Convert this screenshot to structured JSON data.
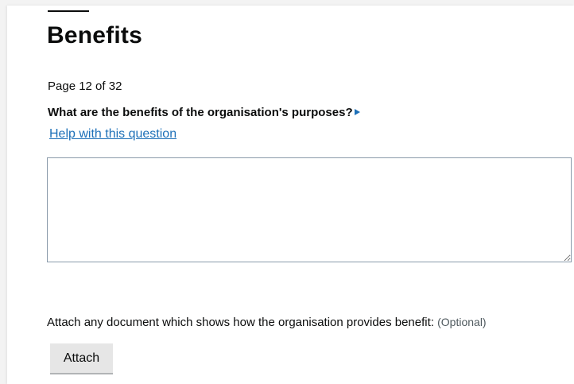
{
  "page": {
    "title": "Benefits",
    "counter": "Page 12 of 32"
  },
  "question": {
    "text": "What are the benefits of the organisation's purposes?",
    "help_link": "Help with this question",
    "answer_value": ""
  },
  "attachment": {
    "label": "Attach any document which shows how the organisation provides benefit:",
    "optional": "(Optional)",
    "button_label": "Attach"
  },
  "icons": {
    "question_expand": "triangle-right-icon"
  },
  "colors": {
    "link": "#1d70b8",
    "text": "#0b0c0c",
    "button_bg": "#e6e6e6"
  }
}
